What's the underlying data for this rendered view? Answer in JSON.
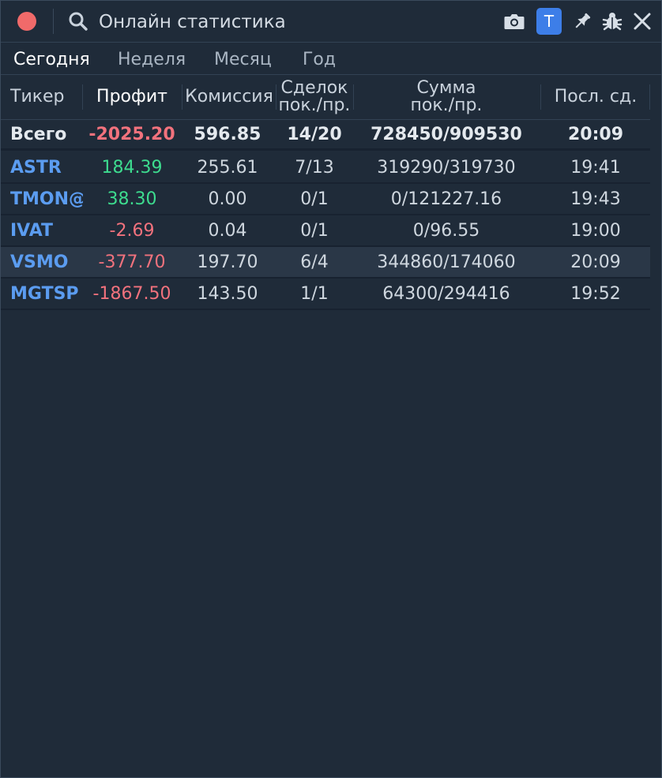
{
  "window": {
    "title": "Онлайн статистика",
    "badge_label": "T",
    "colors": {
      "background": "#1f2b39",
      "close_dot": "#f06a6a",
      "badge": "#3d7ee8",
      "positive": "#3ddc8f",
      "negative": "#f2727d",
      "ticker": "#5b9cf0"
    },
    "icons": [
      "search-icon",
      "camera-icon",
      "pin-icon",
      "bug-icon",
      "close-icon"
    ]
  },
  "tabs": [
    {
      "label": "Сегодня",
      "active": true
    },
    {
      "label": "Неделя",
      "active": false
    },
    {
      "label": "Месяц",
      "active": false
    },
    {
      "label": "Год",
      "active": false
    }
  ],
  "table": {
    "headers": {
      "ticker": "Тикер",
      "profit": "Профит",
      "commission": "Комиссия",
      "deals_line1": "Сделок",
      "deals_line2": "пок./пр.",
      "sum_line1": "Сумма",
      "sum_line2": "пок./пр.",
      "last": "Посл. сд."
    },
    "total": {
      "label": "Всего",
      "profit": "-2025.20",
      "commission": "596.85",
      "deals": "14/20",
      "sum": "728450/909530",
      "last": "20:09"
    },
    "rows": [
      {
        "ticker": "ASTR",
        "profit": "184.39",
        "commission": "255.61",
        "deals": "7/13",
        "sum": "319290/319730",
        "last": "19:41"
      },
      {
        "ticker": "TMON@",
        "profit": "38.30",
        "commission": "0.00",
        "deals": "0/1",
        "sum": "0/121227.16",
        "last": "19:43"
      },
      {
        "ticker": "IVAT",
        "profit": "-2.69",
        "commission": "0.04",
        "deals": "0/1",
        "sum": "0/96.55",
        "last": "19:00"
      },
      {
        "ticker": "VSMO",
        "profit": "-377.70",
        "commission": "197.70",
        "deals": "6/4",
        "sum": "344860/174060",
        "last": "20:09"
      },
      {
        "ticker": "MGTSP",
        "profit": "-1867.50",
        "commission": "143.50",
        "deals": "1/1",
        "sum": "64300/294416",
        "last": "19:52"
      }
    ]
  }
}
